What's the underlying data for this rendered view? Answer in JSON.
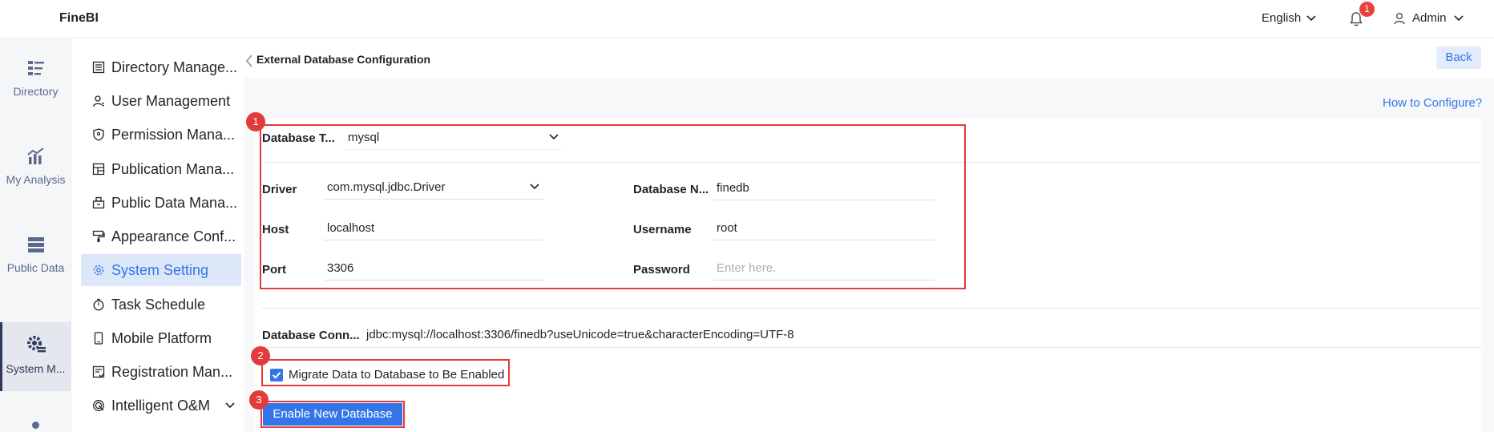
{
  "app": {
    "title": "FineBI"
  },
  "topbar": {
    "language": "English",
    "notification_count": "1",
    "user_name": "Admin"
  },
  "rail": {
    "items": [
      {
        "label": "Directory",
        "icon": "directory-icon"
      },
      {
        "label": "My Analysis",
        "icon": "analysis-icon"
      },
      {
        "label": "Public Data",
        "icon": "public-data-icon"
      },
      {
        "label": "System M...",
        "icon": "system-management-icon"
      }
    ]
  },
  "menu": {
    "items": [
      {
        "label": "Directory Manage...",
        "icon": "list-icon"
      },
      {
        "label": "User Management",
        "icon": "user-icon"
      },
      {
        "label": "Permission Mana...",
        "icon": "shield-icon"
      },
      {
        "label": "Publication Mana...",
        "icon": "layout-icon"
      },
      {
        "label": "Public Data Mana...",
        "icon": "package-icon"
      },
      {
        "label": "Appearance Conf...",
        "icon": "brush-icon"
      },
      {
        "label": "System Setting",
        "icon": "gear-icon"
      },
      {
        "label": "Task Schedule",
        "icon": "timer-icon"
      },
      {
        "label": "Mobile Platform",
        "icon": "phone-icon"
      },
      {
        "label": "Registration Man...",
        "icon": "register-icon"
      },
      {
        "label": "Intelligent O&M",
        "icon": "fingerprint-icon"
      }
    ]
  },
  "page": {
    "title": "External Database Configuration",
    "back_label": "Back",
    "help_link": "How to Configure?"
  },
  "form": {
    "db_type_label": "Database T...",
    "db_type_value": "mysql",
    "driver_label": "Driver",
    "driver_value": "com.mysql.jdbc.Driver",
    "host_label": "Host",
    "host_value": "localhost",
    "port_label": "Port",
    "port_value": "3306",
    "db_name_label": "Database N...",
    "db_name_value": "finedb",
    "username_label": "Username",
    "username_value": "root",
    "password_label": "Password",
    "password_placeholder": "Enter here.",
    "conn_label": "Database Conn...",
    "conn_value": "jdbc:mysql://localhost:3306/finedb?useUnicode=true&characterEncoding=UTF-8",
    "migrate_label": "Migrate Data to Database to Be Enabled",
    "migrate_checked": true,
    "enable_button": "Enable New Database"
  },
  "annotations": [
    "1",
    "2",
    "3"
  ],
  "colors": {
    "accent": "#3476e8",
    "annotation": "#e23b3b",
    "rail_text": "#5a6a8e"
  }
}
